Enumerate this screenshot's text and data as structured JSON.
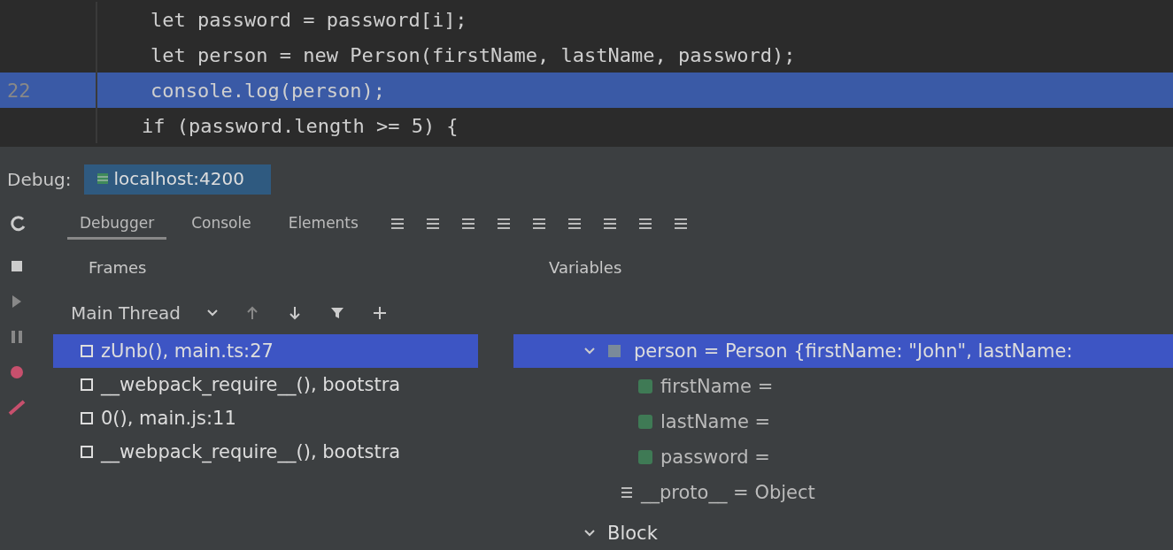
{
  "editor": {
    "lines": [
      {
        "code": "let password = password[i];",
        "current": false
      },
      {
        "code": "let person = new Person(firstName, lastName, password);",
        "current": false
      },
      {
        "number": "22",
        "code": "console.log(person);",
        "current": true
      },
      {
        "code": "if (password.length >= 5) {",
        "current": false
      }
    ]
  },
  "debug": {
    "label": "Debug:",
    "session": "localhost:4200"
  },
  "tabs": [
    {
      "label": "Debugger",
      "selected": true
    },
    {
      "label": "Console",
      "selected": false
    },
    {
      "label": "Elements",
      "selected": false
    }
  ],
  "frames": {
    "title": "Frames",
    "thread": "Main Thread",
    "items": [
      {
        "label": "zUnb(), main.ts:27",
        "selected": true
      },
      {
        "label": "__webpack_require__(), bootstra",
        "selected": false
      },
      {
        "label": "0(), main.js:11",
        "selected": false
      },
      {
        "label": "__webpack_require__(), bootstra",
        "selected": false
      }
    ]
  },
  "variables": {
    "title": "Variables",
    "items": [
      {
        "label": "person = Person {firstName: \"John\", lastName:",
        "selected": true,
        "kind": "object",
        "children": [
          {
            "label": "firstName =",
            "selected": false,
            "kind": "field"
          },
          {
            "label": "lastName =",
            "selected": false,
            "kind": "field"
          },
          {
            "label": "password =",
            "selected": false,
            "kind": "field"
          },
          {
            "label": "__proto__ = Object",
            "selected": false,
            "kind": "proto"
          }
        ]
      },
      {
        "label": "Block",
        "selected": false,
        "kind": "scope"
      }
    ]
  }
}
